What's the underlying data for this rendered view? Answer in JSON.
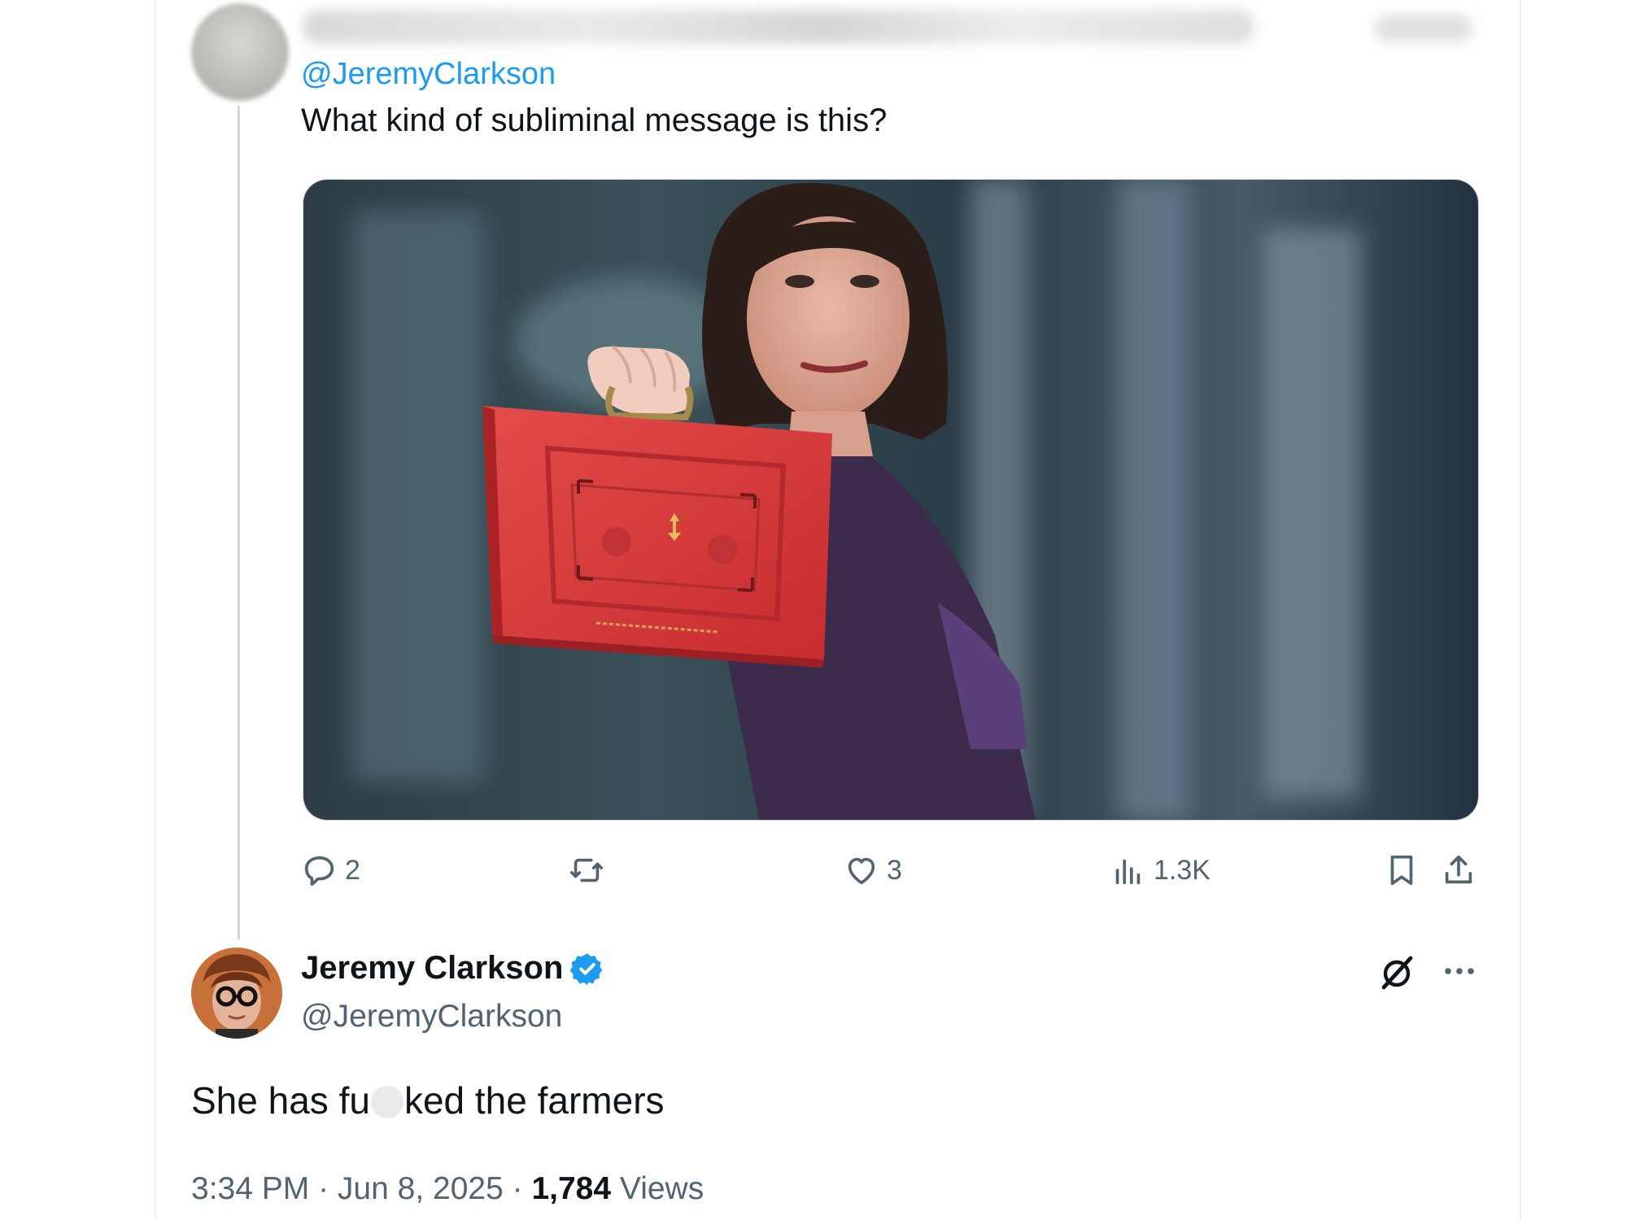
{
  "reply": {
    "mention": "@JeremyClarkson",
    "text": "What kind of subliminal message is this?",
    "media_description_icon": "photo-red-budget-box",
    "actions": {
      "replies": "2",
      "retweets": "",
      "likes": "3",
      "views": "1.3K"
    }
  },
  "tweet": {
    "display_name": "Jeremy Clarkson",
    "handle": "@JeremyClarkson",
    "text_before": "She has f",
    "text_partial": "u",
    "text_after": "ked the farmers",
    "time": "3:34 PM",
    "separator": " · ",
    "date": "Jun 8, 2025",
    "views_count": "1,784",
    "views_label": " Views"
  },
  "colors": {
    "accent": "#1d9bf0",
    "text": "#0f1419",
    "secondary": "#536471",
    "box_red": "#d8393a"
  },
  "icons": [
    "reply-icon",
    "retweet-icon",
    "like-icon",
    "views-icon",
    "bookmark-icon",
    "share-icon",
    "verified-badge-icon",
    "grok-icon",
    "more-icon"
  ]
}
